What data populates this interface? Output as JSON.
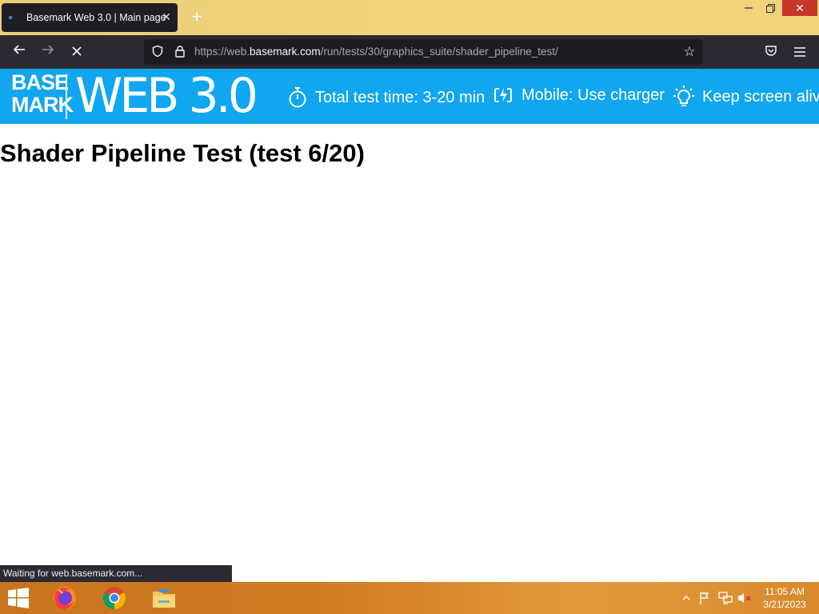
{
  "browser": {
    "tab": {
      "title": "Basemark Web 3.0 | Main page"
    },
    "url": {
      "prefix": "https://web.",
      "domain": "basemark.com",
      "path": "/run/tests/30/graphics_suite/shader_pipeline_test/"
    },
    "status_text": "Waiting for web.basemark.com..."
  },
  "banner": {
    "logo_line1": "BASE",
    "logo_line2": "MARK",
    "logo_product": "WEB 3.0",
    "items": [
      {
        "icon": "stopwatch-icon",
        "label": "Total test time: 3-20 min"
      },
      {
        "icon": "charging-battery-icon",
        "label": "Mobile: Use charger"
      },
      {
        "icon": "lightbulb-icon",
        "label": "Keep screen alive!"
      }
    ],
    "color": "#10a6f0"
  },
  "page": {
    "title": "Shader Pipeline Test (test 6/20)"
  },
  "taskbar": {
    "pinned": [
      "windows-start-icon",
      "firefox-icon",
      "chrome-icon",
      "file-explorer-icon"
    ],
    "clock": {
      "time": "11:05 AM",
      "date": "3/21/2023"
    }
  }
}
